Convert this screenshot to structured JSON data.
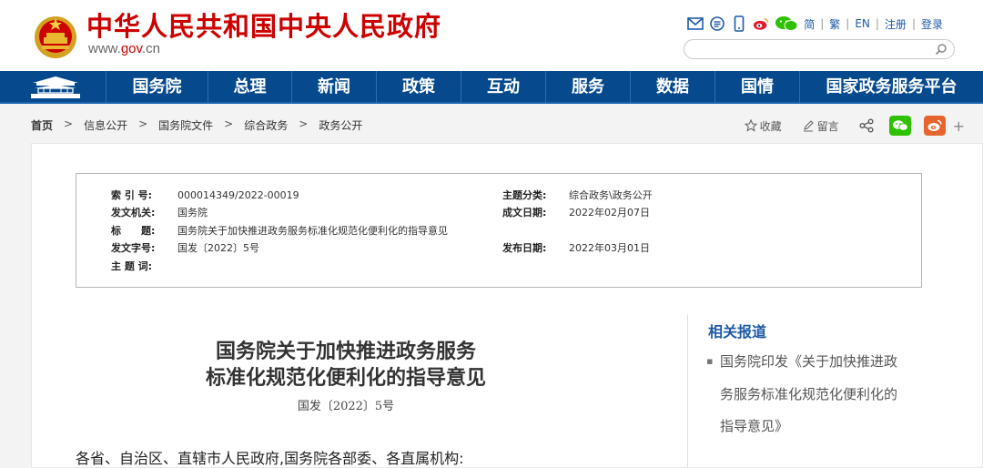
{
  "header": {
    "site_name": "中华人民共和国中央人民政府",
    "domain_prefix": "www.",
    "domain_highlight": "gov",
    "domain_suffix": ".cn",
    "lang_links": [
      "简",
      "繁",
      "EN",
      "注册",
      "登录"
    ],
    "icons": [
      "mail-icon",
      "rss-icon",
      "mobile-icon",
      "weibo-icon",
      "wechat-icon"
    ],
    "search_placeholder": ""
  },
  "nav": {
    "items": [
      "国务院",
      "总理",
      "新闻",
      "政策",
      "互动",
      "服务",
      "数据",
      "国情",
      "国家政务服务平台"
    ]
  },
  "breadcrumb": {
    "items": [
      "首页",
      "信息公开",
      "国务院文件",
      "综合政务",
      "政务公开"
    ],
    "separator": ">"
  },
  "tools": {
    "favorite": "收藏",
    "comment": "留言",
    "plus": "+"
  },
  "info": {
    "index_label": "索 引 号:",
    "index_value": "000014349/2022-00019",
    "topic_label": "主题分类:",
    "topic_value": "综合政务\\政务公开",
    "issuer_label": "发文机关:",
    "issuer_value": "国务院",
    "date_label": "成文日期:",
    "date_value": "2022年02月07日",
    "title_label": "标　　题:",
    "title_value": "国务院关于加快推进政务服务标准化规范化便利化的指导意见",
    "docno_label": "发文字号:",
    "docno_value": "国发〔2022〕5号",
    "pub_label": "发布日期:",
    "pub_value": "2022年03月01日",
    "keywords_label": "主 题 词:",
    "keywords_value": ""
  },
  "article": {
    "title_line1": "国务院关于加快推进政务服务",
    "title_line2": "标准化规范化便利化的指导意见",
    "doc_number": "国发〔2022〕5号",
    "salutation": "各省、自治区、直辖市人民政府,国务院各部委、各直属机构:"
  },
  "related": {
    "title": "相关报道",
    "item_lines": [
      "国务院印发《关于加快推进政",
      "务服务标准化规范化便利化的",
      "指导意见》"
    ]
  },
  "colors": {
    "brand_red": "#cc0000",
    "nav_blue": "#064a8d",
    "link_blue": "#1e5aa8",
    "wechat_green": "#2dc100",
    "weibo_orange": "#e6652e"
  }
}
